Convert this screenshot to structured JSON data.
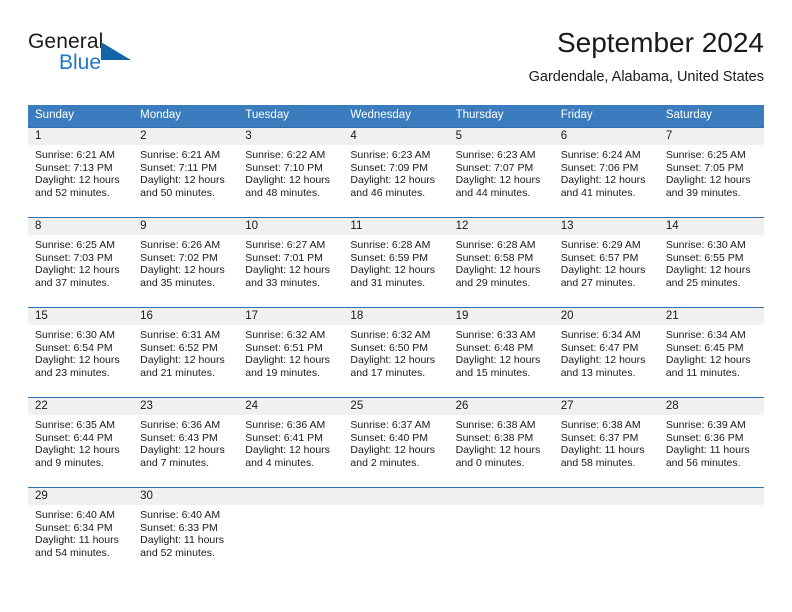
{
  "brand": {
    "name_part1": "General",
    "name_part2": "Blue",
    "triangle_color": "#1664a8"
  },
  "header": {
    "title": "September 2024",
    "subtitle": "Gardendale, Alabama, United States"
  },
  "theme": {
    "header_bg": "#3a7cbe",
    "divider": "#2f6fad",
    "daynum_band": "#f0f0f0",
    "brand_blue": "#1f77c4"
  },
  "calendar": {
    "weekdays": [
      "Sunday",
      "Monday",
      "Tuesday",
      "Wednesday",
      "Thursday",
      "Friday",
      "Saturday"
    ],
    "weeks": [
      [
        {
          "day": "1",
          "sunrise": "Sunrise: 6:21 AM",
          "sunset": "Sunset: 7:13 PM",
          "daylight1": "Daylight: 12 hours",
          "daylight2": "and 52 minutes."
        },
        {
          "day": "2",
          "sunrise": "Sunrise: 6:21 AM",
          "sunset": "Sunset: 7:11 PM",
          "daylight1": "Daylight: 12 hours",
          "daylight2": "and 50 minutes."
        },
        {
          "day": "3",
          "sunrise": "Sunrise: 6:22 AM",
          "sunset": "Sunset: 7:10 PM",
          "daylight1": "Daylight: 12 hours",
          "daylight2": "and 48 minutes."
        },
        {
          "day": "4",
          "sunrise": "Sunrise: 6:23 AM",
          "sunset": "Sunset: 7:09 PM",
          "daylight1": "Daylight: 12 hours",
          "daylight2": "and 46 minutes."
        },
        {
          "day": "5",
          "sunrise": "Sunrise: 6:23 AM",
          "sunset": "Sunset: 7:07 PM",
          "daylight1": "Daylight: 12 hours",
          "daylight2": "and 44 minutes."
        },
        {
          "day": "6",
          "sunrise": "Sunrise: 6:24 AM",
          "sunset": "Sunset: 7:06 PM",
          "daylight1": "Daylight: 12 hours",
          "daylight2": "and 41 minutes."
        },
        {
          "day": "7",
          "sunrise": "Sunrise: 6:25 AM",
          "sunset": "Sunset: 7:05 PM",
          "daylight1": "Daylight: 12 hours",
          "daylight2": "and 39 minutes."
        }
      ],
      [
        {
          "day": "8",
          "sunrise": "Sunrise: 6:25 AM",
          "sunset": "Sunset: 7:03 PM",
          "daylight1": "Daylight: 12 hours",
          "daylight2": "and 37 minutes."
        },
        {
          "day": "9",
          "sunrise": "Sunrise: 6:26 AM",
          "sunset": "Sunset: 7:02 PM",
          "daylight1": "Daylight: 12 hours",
          "daylight2": "and 35 minutes."
        },
        {
          "day": "10",
          "sunrise": "Sunrise: 6:27 AM",
          "sunset": "Sunset: 7:01 PM",
          "daylight1": "Daylight: 12 hours",
          "daylight2": "and 33 minutes."
        },
        {
          "day": "11",
          "sunrise": "Sunrise: 6:28 AM",
          "sunset": "Sunset: 6:59 PM",
          "daylight1": "Daylight: 12 hours",
          "daylight2": "and 31 minutes."
        },
        {
          "day": "12",
          "sunrise": "Sunrise: 6:28 AM",
          "sunset": "Sunset: 6:58 PM",
          "daylight1": "Daylight: 12 hours",
          "daylight2": "and 29 minutes."
        },
        {
          "day": "13",
          "sunrise": "Sunrise: 6:29 AM",
          "sunset": "Sunset: 6:57 PM",
          "daylight1": "Daylight: 12 hours",
          "daylight2": "and 27 minutes."
        },
        {
          "day": "14",
          "sunrise": "Sunrise: 6:30 AM",
          "sunset": "Sunset: 6:55 PM",
          "daylight1": "Daylight: 12 hours",
          "daylight2": "and 25 minutes."
        }
      ],
      [
        {
          "day": "15",
          "sunrise": "Sunrise: 6:30 AM",
          "sunset": "Sunset: 6:54 PM",
          "daylight1": "Daylight: 12 hours",
          "daylight2": "and 23 minutes."
        },
        {
          "day": "16",
          "sunrise": "Sunrise: 6:31 AM",
          "sunset": "Sunset: 6:52 PM",
          "daylight1": "Daylight: 12 hours",
          "daylight2": "and 21 minutes."
        },
        {
          "day": "17",
          "sunrise": "Sunrise: 6:32 AM",
          "sunset": "Sunset: 6:51 PM",
          "daylight1": "Daylight: 12 hours",
          "daylight2": "and 19 minutes."
        },
        {
          "day": "18",
          "sunrise": "Sunrise: 6:32 AM",
          "sunset": "Sunset: 6:50 PM",
          "daylight1": "Daylight: 12 hours",
          "daylight2": "and 17 minutes."
        },
        {
          "day": "19",
          "sunrise": "Sunrise: 6:33 AM",
          "sunset": "Sunset: 6:48 PM",
          "daylight1": "Daylight: 12 hours",
          "daylight2": "and 15 minutes."
        },
        {
          "day": "20",
          "sunrise": "Sunrise: 6:34 AM",
          "sunset": "Sunset: 6:47 PM",
          "daylight1": "Daylight: 12 hours",
          "daylight2": "and 13 minutes."
        },
        {
          "day": "21",
          "sunrise": "Sunrise: 6:34 AM",
          "sunset": "Sunset: 6:45 PM",
          "daylight1": "Daylight: 12 hours",
          "daylight2": "and 11 minutes."
        }
      ],
      [
        {
          "day": "22",
          "sunrise": "Sunrise: 6:35 AM",
          "sunset": "Sunset: 6:44 PM",
          "daylight1": "Daylight: 12 hours",
          "daylight2": "and 9 minutes."
        },
        {
          "day": "23",
          "sunrise": "Sunrise: 6:36 AM",
          "sunset": "Sunset: 6:43 PM",
          "daylight1": "Daylight: 12 hours",
          "daylight2": "and 7 minutes."
        },
        {
          "day": "24",
          "sunrise": "Sunrise: 6:36 AM",
          "sunset": "Sunset: 6:41 PM",
          "daylight1": "Daylight: 12 hours",
          "daylight2": "and 4 minutes."
        },
        {
          "day": "25",
          "sunrise": "Sunrise: 6:37 AM",
          "sunset": "Sunset: 6:40 PM",
          "daylight1": "Daylight: 12 hours",
          "daylight2": "and 2 minutes."
        },
        {
          "day": "26",
          "sunrise": "Sunrise: 6:38 AM",
          "sunset": "Sunset: 6:38 PM",
          "daylight1": "Daylight: 12 hours",
          "daylight2": "and 0 minutes."
        },
        {
          "day": "27",
          "sunrise": "Sunrise: 6:38 AM",
          "sunset": "Sunset: 6:37 PM",
          "daylight1": "Daylight: 11 hours",
          "daylight2": "and 58 minutes."
        },
        {
          "day": "28",
          "sunrise": "Sunrise: 6:39 AM",
          "sunset": "Sunset: 6:36 PM",
          "daylight1": "Daylight: 11 hours",
          "daylight2": "and 56 minutes."
        }
      ],
      [
        {
          "day": "29",
          "sunrise": "Sunrise: 6:40 AM",
          "sunset": "Sunset: 6:34 PM",
          "daylight1": "Daylight: 11 hours",
          "daylight2": "and 54 minutes."
        },
        {
          "day": "30",
          "sunrise": "Sunrise: 6:40 AM",
          "sunset": "Sunset: 6:33 PM",
          "daylight1": "Daylight: 11 hours",
          "daylight2": "and 52 minutes."
        },
        {
          "day": "",
          "sunrise": "",
          "sunset": "",
          "daylight1": "",
          "daylight2": ""
        },
        {
          "day": "",
          "sunrise": "",
          "sunset": "",
          "daylight1": "",
          "daylight2": ""
        },
        {
          "day": "",
          "sunrise": "",
          "sunset": "",
          "daylight1": "",
          "daylight2": ""
        },
        {
          "day": "",
          "sunrise": "",
          "sunset": "",
          "daylight1": "",
          "daylight2": ""
        },
        {
          "day": "",
          "sunrise": "",
          "sunset": "",
          "daylight1": "",
          "daylight2": ""
        }
      ]
    ]
  }
}
